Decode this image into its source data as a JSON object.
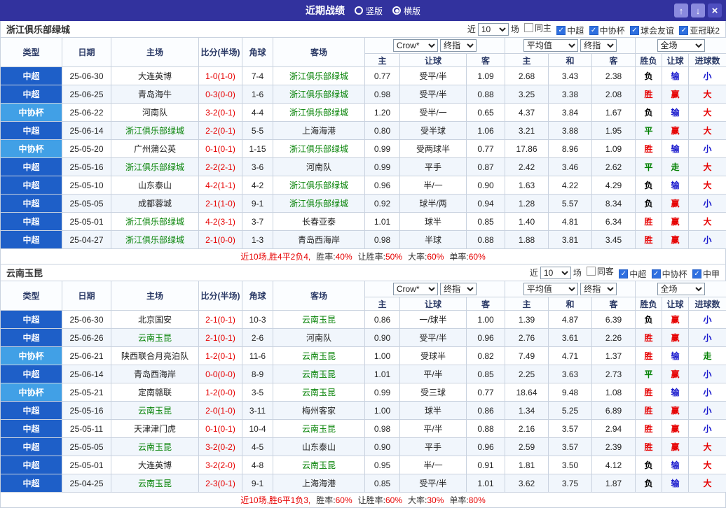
{
  "colors": {
    "topbar_bg": "#32329e",
    "csl_type_blue": "#1e5fc8",
    "cup_type_blue": "#41a0e6",
    "focus_team_green": "#008000",
    "score_red": "#e60000",
    "result_red": "#e60000",
    "result_blue": "#1515cc",
    "result_green": "#008000"
  },
  "topbar": {
    "title": "近期战绩",
    "radios": [
      {
        "label": "竖版",
        "selected": false
      },
      {
        "label": "横版",
        "selected": true
      }
    ],
    "up_icon": "↑",
    "down_icon": "↓",
    "close_icon": "×"
  },
  "header": {
    "near_label": "近",
    "count_value": "10",
    "games_label": "场",
    "odds_select": "Crow*",
    "odds_time_select": "终指",
    "avg_select": "平均值",
    "avg_time_select": "终指",
    "scope_select": "全场",
    "columns": [
      "类型",
      "日期",
      "主场",
      "比分(半场)",
      "角球",
      "客场",
      "主",
      "让球",
      "客",
      "主",
      "和",
      "客",
      "胜负",
      "让球",
      "进球数"
    ]
  },
  "sections": [
    {
      "team": "浙江俱乐部绿城",
      "filters": [
        {
          "label": "同主",
          "checked": false
        },
        {
          "label": "中超",
          "checked": true
        },
        {
          "label": "中协杯",
          "checked": true
        },
        {
          "label": "球会友谊",
          "checked": true
        },
        {
          "label": "亚冠联2",
          "checked": true
        }
      ],
      "rows": [
        {
          "type": "中超",
          "type_cls": "t-csl",
          "date": "25-06-30",
          "home": "大连英博",
          "home_cls": "",
          "score": "1-0(1-0)",
          "corner": "7-4",
          "away": "浙江俱乐部绿城",
          "away_cls": "focus",
          "h1": "0.77",
          "hd": "受平/半",
          "a1": "1.09",
          "h2": "2.68",
          "d2": "3.43",
          "a2": "2.38",
          "wl": "负",
          "wl_cls": "c-dark",
          "hr": "输",
          "hr_cls": "c-blue",
          "gr": "小",
          "gr_cls": "c-blue"
        },
        {
          "type": "中超",
          "type_cls": "t-csl",
          "date": "25-06-25",
          "home": "青岛海牛",
          "home_cls": "",
          "score": "0-3(0-0)",
          "corner": "1-6",
          "away": "浙江俱乐部绿城",
          "away_cls": "focus",
          "h1": "0.98",
          "hd": "受平/半",
          "a1": "0.88",
          "h2": "3.25",
          "d2": "3.38",
          "a2": "2.08",
          "wl": "胜",
          "wl_cls": "c-red",
          "hr": "赢",
          "hr_cls": "c-red",
          "gr": "大",
          "gr_cls": "c-red"
        },
        {
          "type": "中协杯",
          "type_cls": "t-cup",
          "date": "25-06-22",
          "home": "河南队",
          "home_cls": "",
          "score": "3-2(0-1)",
          "corner": "4-4",
          "away": "浙江俱乐部绿城",
          "away_cls": "focus",
          "h1": "1.20",
          "hd": "受半/一",
          "a1": "0.65",
          "h2": "4.37",
          "d2": "3.84",
          "a2": "1.67",
          "wl": "负",
          "wl_cls": "c-dark",
          "hr": "输",
          "hr_cls": "c-blue",
          "gr": "大",
          "gr_cls": "c-red"
        },
        {
          "type": "中超",
          "type_cls": "t-csl",
          "date": "25-06-14",
          "home": "浙江俱乐部绿城",
          "home_cls": "focus",
          "score": "2-2(0-1)",
          "corner": "5-5",
          "away": "上海海港",
          "away_cls": "",
          "h1": "0.80",
          "hd": "受半球",
          "a1": "1.06",
          "h2": "3.21",
          "d2": "3.88",
          "a2": "1.95",
          "wl": "平",
          "wl_cls": "c-green",
          "hr": "赢",
          "hr_cls": "c-red",
          "gr": "大",
          "gr_cls": "c-red"
        },
        {
          "type": "中协杯",
          "type_cls": "t-cup",
          "date": "25-05-20",
          "home": "广州蒲公英",
          "home_cls": "",
          "score": "0-1(0-1)",
          "corner": "1-15",
          "away": "浙江俱乐部绿城",
          "away_cls": "focus",
          "h1": "0.99",
          "hd": "受两球半",
          "a1": "0.77",
          "h2": "17.86",
          "d2": "8.96",
          "a2": "1.09",
          "wl": "胜",
          "wl_cls": "c-red",
          "hr": "输",
          "hr_cls": "c-blue",
          "gr": "小",
          "gr_cls": "c-blue"
        },
        {
          "type": "中超",
          "type_cls": "t-csl",
          "date": "25-05-16",
          "home": "浙江俱乐部绿城",
          "home_cls": "focus",
          "score": "2-2(2-1)",
          "corner": "3-6",
          "away": "河南队",
          "away_cls": "",
          "h1": "0.99",
          "hd": "平手",
          "a1": "0.87",
          "h2": "2.42",
          "d2": "3.46",
          "a2": "2.62",
          "wl": "平",
          "wl_cls": "c-green",
          "hr": "走",
          "hr_cls": "c-green",
          "gr": "大",
          "gr_cls": "c-red"
        },
        {
          "type": "中超",
          "type_cls": "t-csl",
          "date": "25-05-10",
          "home": "山东泰山",
          "home_cls": "",
          "score": "4-2(1-1)",
          "corner": "4-2",
          "away": "浙江俱乐部绿城",
          "away_cls": "focus",
          "h1": "0.96",
          "hd": "半/一",
          "a1": "0.90",
          "h2": "1.63",
          "d2": "4.22",
          "a2": "4.29",
          "wl": "负",
          "wl_cls": "c-dark",
          "hr": "输",
          "hr_cls": "c-blue",
          "gr": "大",
          "gr_cls": "c-red"
        },
        {
          "type": "中超",
          "type_cls": "t-csl",
          "date": "25-05-05",
          "home": "成都蓉城",
          "home_cls": "",
          "score": "2-1(1-0)",
          "corner": "9-1",
          "away": "浙江俱乐部绿城",
          "away_cls": "focus",
          "h1": "0.92",
          "hd": "球半/两",
          "a1": "0.94",
          "h2": "1.28",
          "d2": "5.57",
          "a2": "8.34",
          "wl": "负",
          "wl_cls": "c-dark",
          "hr": "赢",
          "hr_cls": "c-red",
          "gr": "小",
          "gr_cls": "c-blue"
        },
        {
          "type": "中超",
          "type_cls": "t-csl",
          "date": "25-05-01",
          "home": "浙江俱乐部绿城",
          "home_cls": "focus",
          "score": "4-2(3-1)",
          "corner": "3-7",
          "away": "长春亚泰",
          "away_cls": "",
          "h1": "1.01",
          "hd": "球半",
          "a1": "0.85",
          "h2": "1.40",
          "d2": "4.81",
          "a2": "6.34",
          "wl": "胜",
          "wl_cls": "c-red",
          "hr": "赢",
          "hr_cls": "c-red",
          "gr": "大",
          "gr_cls": "c-red"
        },
        {
          "type": "中超",
          "type_cls": "t-csl",
          "date": "25-04-27",
          "home": "浙江俱乐部绿城",
          "home_cls": "focus",
          "score": "2-1(0-0)",
          "corner": "1-3",
          "away": "青岛西海岸",
          "away_cls": "",
          "h1": "0.98",
          "hd": "半球",
          "a1": "0.88",
          "h2": "1.88",
          "d2": "3.81",
          "a2": "3.45",
          "wl": "胜",
          "wl_cls": "c-red",
          "hr": "赢",
          "hr_cls": "c-red",
          "gr": "小",
          "gr_cls": "c-blue"
        }
      ],
      "summary": {
        "prefix": "近10场,胜4平2负4,",
        "stats": [
          {
            "label": "胜率:",
            "value": "40%"
          },
          {
            "label": "让胜率:",
            "value": "50%"
          },
          {
            "label": "大率:",
            "value": "60%"
          },
          {
            "label": "单率:",
            "value": "60%"
          }
        ]
      }
    },
    {
      "team": "云南玉昆",
      "filters": [
        {
          "label": "同客",
          "checked": false
        },
        {
          "label": "中超",
          "checked": true
        },
        {
          "label": "中协杯",
          "checked": true
        },
        {
          "label": "中甲",
          "checked": true
        }
      ],
      "rows": [
        {
          "type": "中超",
          "type_cls": "t-csl",
          "date": "25-06-30",
          "home": "北京国安",
          "home_cls": "",
          "score": "2-1(0-1)",
          "corner": "10-3",
          "away": "云南玉昆",
          "away_cls": "focus",
          "h1": "0.86",
          "hd": "一/球半",
          "a1": "1.00",
          "h2": "1.39",
          "d2": "4.87",
          "a2": "6.39",
          "wl": "负",
          "wl_cls": "c-dark",
          "hr": "赢",
          "hr_cls": "c-red",
          "gr": "小",
          "gr_cls": "c-blue"
        },
        {
          "type": "中超",
          "type_cls": "t-csl",
          "date": "25-06-26",
          "home": "云南玉昆",
          "home_cls": "focus",
          "score": "2-1(0-1)",
          "corner": "2-6",
          "away": "河南队",
          "away_cls": "",
          "h1": "0.90",
          "hd": "受平/半",
          "a1": "0.96",
          "h2": "2.76",
          "d2": "3.61",
          "a2": "2.26",
          "wl": "胜",
          "wl_cls": "c-red",
          "hr": "赢",
          "hr_cls": "c-red",
          "gr": "小",
          "gr_cls": "c-blue"
        },
        {
          "type": "中协杯",
          "type_cls": "t-cup",
          "date": "25-06-21",
          "home": "陕西联合月亮泊队",
          "home_cls": "",
          "score": "1-2(0-1)",
          "corner": "11-6",
          "away": "云南玉昆",
          "away_cls": "focus",
          "h1": "1.00",
          "hd": "受球半",
          "a1": "0.82",
          "h2": "7.49",
          "d2": "4.71",
          "a2": "1.37",
          "wl": "胜",
          "wl_cls": "c-red",
          "hr": "输",
          "hr_cls": "c-blue",
          "gr": "走",
          "gr_cls": "c-green"
        },
        {
          "type": "中超",
          "type_cls": "t-csl",
          "date": "25-06-14",
          "home": "青岛西海岸",
          "home_cls": "",
          "score": "0-0(0-0)",
          "corner": "8-9",
          "away": "云南玉昆",
          "away_cls": "focus",
          "h1": "1.01",
          "hd": "平/半",
          "a1": "0.85",
          "h2": "2.25",
          "d2": "3.63",
          "a2": "2.73",
          "wl": "平",
          "wl_cls": "c-green",
          "hr": "赢",
          "hr_cls": "c-red",
          "gr": "小",
          "gr_cls": "c-blue"
        },
        {
          "type": "中协杯",
          "type_cls": "t-cup",
          "date": "25-05-21",
          "home": "定南赣联",
          "home_cls": "",
          "score": "1-2(0-0)",
          "corner": "3-5",
          "away": "云南玉昆",
          "away_cls": "focus",
          "h1": "0.99",
          "hd": "受三球",
          "a1": "0.77",
          "h2": "18.64",
          "d2": "9.48",
          "a2": "1.08",
          "wl": "胜",
          "wl_cls": "c-red",
          "hr": "输",
          "hr_cls": "c-blue",
          "gr": "小",
          "gr_cls": "c-blue"
        },
        {
          "type": "中超",
          "type_cls": "t-csl",
          "date": "25-05-16",
          "home": "云南玉昆",
          "home_cls": "focus",
          "score": "2-0(1-0)",
          "corner": "3-11",
          "away": "梅州客家",
          "away_cls": "",
          "h1": "1.00",
          "hd": "球半",
          "a1": "0.86",
          "h2": "1.34",
          "d2": "5.25",
          "a2": "6.89",
          "wl": "胜",
          "wl_cls": "c-red",
          "hr": "赢",
          "hr_cls": "c-red",
          "gr": "小",
          "gr_cls": "c-blue"
        },
        {
          "type": "中超",
          "type_cls": "t-csl",
          "date": "25-05-11",
          "home": "天津津门虎",
          "home_cls": "",
          "score": "0-1(0-1)",
          "corner": "10-4",
          "away": "云南玉昆",
          "away_cls": "focus",
          "h1": "0.98",
          "hd": "平/半",
          "a1": "0.88",
          "h2": "2.16",
          "d2": "3.57",
          "a2": "2.94",
          "wl": "胜",
          "wl_cls": "c-red",
          "hr": "赢",
          "hr_cls": "c-red",
          "gr": "小",
          "gr_cls": "c-blue"
        },
        {
          "type": "中超",
          "type_cls": "t-csl",
          "date": "25-05-05",
          "home": "云南玉昆",
          "home_cls": "focus",
          "score": "3-2(0-2)",
          "corner": "4-5",
          "away": "山东泰山",
          "away_cls": "",
          "h1": "0.90",
          "hd": "平手",
          "a1": "0.96",
          "h2": "2.59",
          "d2": "3.57",
          "a2": "2.39",
          "wl": "胜",
          "wl_cls": "c-red",
          "hr": "赢",
          "hr_cls": "c-red",
          "gr": "大",
          "gr_cls": "c-red"
        },
        {
          "type": "中超",
          "type_cls": "t-csl",
          "date": "25-05-01",
          "home": "大连英博",
          "home_cls": "",
          "score": "3-2(2-0)",
          "corner": "4-8",
          "away": "云南玉昆",
          "away_cls": "focus",
          "h1": "0.95",
          "hd": "半/一",
          "a1": "0.91",
          "h2": "1.81",
          "d2": "3.50",
          "a2": "4.12",
          "wl": "负",
          "wl_cls": "c-dark",
          "hr": "输",
          "hr_cls": "c-blue",
          "gr": "大",
          "gr_cls": "c-red"
        },
        {
          "type": "中超",
          "type_cls": "t-csl",
          "date": "25-04-25",
          "home": "云南玉昆",
          "home_cls": "focus",
          "score": "2-3(0-1)",
          "corner": "9-1",
          "away": "上海海港",
          "away_cls": "",
          "h1": "0.85",
          "hd": "受平/半",
          "a1": "1.01",
          "h2": "3.62",
          "d2": "3.75",
          "a2": "1.87",
          "wl": "负",
          "wl_cls": "c-dark",
          "hr": "输",
          "hr_cls": "c-blue",
          "gr": "大",
          "gr_cls": "c-red"
        }
      ],
      "summary": {
        "prefix": "近10场,胜6平1负3,",
        "stats": [
          {
            "label": "胜率:",
            "value": "60%"
          },
          {
            "label": "让胜率:",
            "value": "60%"
          },
          {
            "label": "大率:",
            "value": "30%"
          },
          {
            "label": "单率:",
            "value": "80%"
          }
        ]
      }
    }
  ]
}
